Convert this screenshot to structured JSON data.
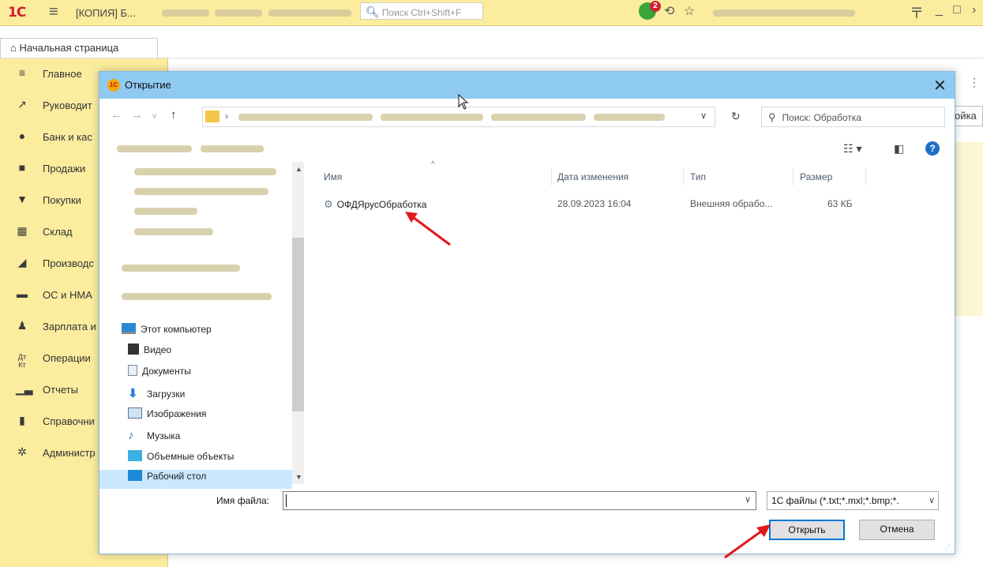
{
  "app": {
    "logo": "1С",
    "title": "[КОПИЯ] Б...",
    "search_placeholder": "Поиск Ctrl+Shift+F",
    "notifications_count": "2"
  },
  "home_tab": {
    "label": "Начальная страница"
  },
  "sidebar": {
    "items": [
      {
        "label": "Главное",
        "icon": "menu-icon"
      },
      {
        "label": "Руководит",
        "icon": "trend-icon"
      },
      {
        "label": "Банк и кас",
        "icon": "coin-icon"
      },
      {
        "label": "Продажи",
        "icon": "bag-icon"
      },
      {
        "label": "Покупки",
        "icon": "cart-icon"
      },
      {
        "label": "Склад",
        "icon": "warehouse-icon"
      },
      {
        "label": "Производс",
        "icon": "factory-icon"
      },
      {
        "label": "ОС и НМА",
        "icon": "truck-icon"
      },
      {
        "label": "Зарплата и",
        "icon": "person-icon"
      },
      {
        "label": "Операции",
        "icon": "dt-kt-icon"
      },
      {
        "label": "Отчеты",
        "icon": "bar-chart-icon"
      },
      {
        "label": "Справочни",
        "icon": "book-icon"
      },
      {
        "label": "Администр",
        "icon": "gear-icon"
      }
    ]
  },
  "right_stub": {
    "label": "ойка"
  },
  "dialog": {
    "title": "Открытие",
    "search_placeholder": "Поиск: Обработка",
    "columns": {
      "name": "Имя",
      "date": "Дата изменения",
      "type": "Тип",
      "size": "Размер"
    },
    "files": [
      {
        "name": "ОФДЯрусОбработка",
        "date": "28.09.2023 16:04",
        "type": "Внешняя обрабо...",
        "size": "63 КБ"
      }
    ],
    "tree": {
      "computer": "Этот компьютер",
      "items": [
        "Видео",
        "Документы",
        "Загрузки",
        "Изображения",
        "Музыка",
        "Объемные объекты",
        "Рабочий стол"
      ]
    },
    "filename_label": "Имя файла:",
    "filename_value": "",
    "filetype_value": "1С файлы (*.txt;*.mxl;*.bmp;*.",
    "open_button": "Открыть",
    "cancel_button": "Отмена"
  },
  "colors": {
    "topbar": "#fbec9e",
    "dialog_titlebar": "#8fcaf2",
    "selection": "#cce8ff",
    "accent": "#0078d7",
    "annotation_arrow": "#e0191b"
  }
}
